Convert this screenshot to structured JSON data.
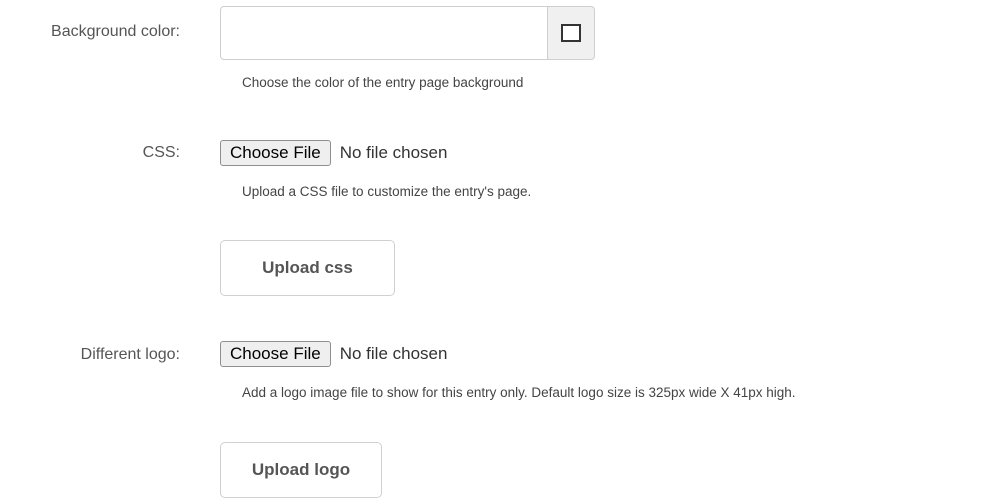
{
  "background_color": {
    "label": "Background color:",
    "value": "",
    "help": "Choose the color of the entry page background",
    "swatch_icon": "color-swatch-icon",
    "swatch_color": "#ffffff"
  },
  "css": {
    "label": "CSS:",
    "choose_file_label": "Choose File",
    "file_status": "No file chosen",
    "help": "Upload a CSS file to customize the entry's page.",
    "upload_label": "Upload css"
  },
  "logo": {
    "label": "Different logo:",
    "choose_file_label": "Choose File",
    "file_status": "No file chosen",
    "help": "Add a logo image file to show for this entry only. Default logo size is 325px wide X 41px high.",
    "upload_label": "Upload logo"
  }
}
